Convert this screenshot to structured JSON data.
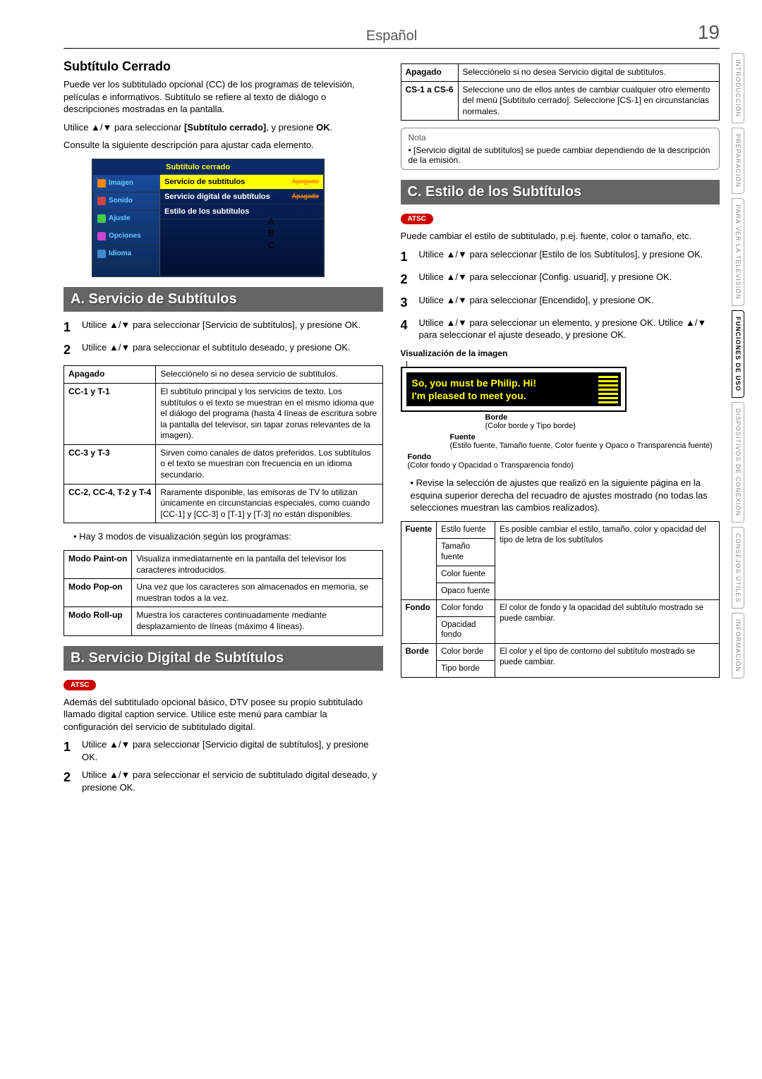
{
  "header": {
    "lang": "Español",
    "page_number": "19"
  },
  "side_tabs": [
    "INTRODUCCIÓN",
    "PREPARACIÓN",
    "PARA VER LA TELEVISIÓN",
    "FUNCIONES DE USO",
    "DISPOSITIVOS DE CONEXIÓN",
    "CONSEJOS ÚTILES",
    "INFORMACIÓN"
  ],
  "left": {
    "h2": "Subtítulo Cerrado",
    "p1": "Puede ver los subtitulado opcional (CC) de los programas de televisión, películas e informativos. Subtítulo se refiere al texto de diálogo o descripciones mostradas en la pantalla.",
    "p2a": "Utilice ▲/▼ para seleccionar ",
    "p2b": "[Subtítulo cerrado]",
    "p2c": ", y presione ",
    "p2d": "OK",
    "p2e": ".",
    "p3": "Consulte la siguiente descripción para ajustar cada elemento.",
    "tv_menu": {
      "title": "Subtítulo cerrado",
      "side": [
        "Imagen",
        "Sonido",
        "Ajuste",
        "Opciones",
        "Idioma"
      ],
      "rows": [
        {
          "label": "Servicio de subtítulos",
          "val": "Apagado"
        },
        {
          "label": "Servicio digital de subtítulos",
          "val": "Apagado"
        },
        {
          "label": "Estilo de los subtítulos",
          "val": ""
        }
      ],
      "abc": [
        "A",
        "B",
        "C"
      ]
    },
    "sectionA": "A. Servicio de Subtítulos",
    "stepsA": [
      {
        "n": "1",
        "t": "Utilice ▲/▼ para seleccionar [Servicio de subtítulos], y presione OK."
      },
      {
        "n": "2",
        "t": "Utilice ▲/▼ para seleccionar el subtítulo deseado, y presione OK."
      }
    ],
    "tableA": [
      {
        "k": "Apagado",
        "v": "Selecciónelo si no desea servicio de subtítulos."
      },
      {
        "k": "CC-1 y T-1",
        "v": "El subtítulo principal y los servicios de texto. Los subtítulos o el texto se muestran en el mismo idioma que el diálogo del programa (hasta 4 líneas de escritura sobre la pantalla del televisor, sin tapar zonas relevantes de la imagen)."
      },
      {
        "k": "CC-3 y T-3",
        "v": "Sirven como canales de datos preferidos. Los subtítulos o el texto se muestran con frecuencia en un idioma secundario."
      },
      {
        "k": "CC-2, CC-4, T-2 y T-4",
        "v": "Raramente disponible, las emisoras de TV lo utilizan únicamente en circunstancias especiales, como cuando [CC-1] y [CC-3] o [T-1] y [T-3] no están disponibles."
      }
    ],
    "bulletA": "Hay 3 modos de visualización según los programas:",
    "tableModes": [
      {
        "k": "Modo Paint-on",
        "v": "Visualiza inmediatamente en la pantalla del televisor los caracteres introducidos."
      },
      {
        "k": "Modo Pop-on",
        "v": "Una vez que los caracteres son almacenados en memoria, se muestran todos a la vez."
      },
      {
        "k": "Modo Roll-up",
        "v": "Muestra los caracteres continuadamente mediante desplazamiento de líneas (máximo 4 líneas)."
      }
    ],
    "sectionB": "B. Servicio Digital de Subtítulos",
    "atsc": "ATSC",
    "pB": "Además del subtitulado opcional básico, DTV posee su propio subtitulado llamado digital caption service. Utilice este menú para cambiar la configuración del servicio de subtitulado digital.",
    "stepsB": [
      {
        "n": "1",
        "t": "Utilice ▲/▼ para seleccionar [Servicio digital de subtítulos], y presione OK."
      },
      {
        "n": "2",
        "t": "Utilice ▲/▼ para seleccionar el servicio de subtitulado digital deseado, y presione OK."
      }
    ]
  },
  "right": {
    "tableTop": [
      {
        "k": "Apagado",
        "v": "Selecciónelo si no desea Servicio digital de subtítulos."
      },
      {
        "k": "CS-1 a CS-6",
        "v": "Seleccione uno de ellos antes de cambiar cualquier otro elemento del menú [Subtítulo cerrado]. Seleccione [CS-1] en circunstancias normales."
      }
    ],
    "note_title": "Nota",
    "note_text": "[Servicio digital de subtítulos] se puede cambiar dependiendo de la descripción de la emisión.",
    "sectionC": "C. Estilo de los Subtítulos",
    "pC": "Puede cambiar el estilo de subtitulado, p.ej. fuente, color o tamaño, etc.",
    "stepsC": [
      {
        "n": "1",
        "t": "Utilice ▲/▼ para seleccionar [Estilo de los Subtítulos], y presione OK."
      },
      {
        "n": "2",
        "t": "Utilice ▲/▼ para seleccionar [Config. usuarid], y presione OK."
      },
      {
        "n": "3",
        "t": "Utilice ▲/▼ para seleccionar [Encendido], y presione OK."
      },
      {
        "n": "4",
        "t": "Utilice ▲/▼ para seleccionar un elemento, y presione OK. Utilice ▲/▼ para seleccionar el ajuste deseado, y presione OK."
      }
    ],
    "diagram": {
      "title": "Visualización de la imagen",
      "caption1": "So, you must be Philip. Hi!",
      "caption2": "I'm pleased to meet you.",
      "borde_lbl": "Borde",
      "borde_txt": "(Color borde y Tipo borde)",
      "fuente_lbl": "Fuente",
      "fuente_txt": "(Estilo fuente, Tamaño fuente, Color fuente y Opaco o Transparencia fuente)",
      "fondo_lbl": "Fondo",
      "fondo_txt": "(Color fondo y Opacidad o Transparencia fondo)"
    },
    "bulletC": "Revise la selección de ajustes que realizó en la siguiente página en la esquina superior derecha del recuadro de ajustes mostrado (no todas las selecciones muestran las cambios realizados).",
    "settings": [
      {
        "cat": "Fuente",
        "rows": [
          "Estilo fuente",
          "Tamaño fuente",
          "Color fuente",
          "Opaco fuente"
        ],
        "desc": "Es posible cambiar el estilo, tamaño, color y opacidad del tipo de letra de los subtítulos"
      },
      {
        "cat": "Fondo",
        "rows": [
          "Color fondo",
          "Opacidad fondo"
        ],
        "desc": "El color de fondo y la opacidad del subtítulo mostrado se puede cambiar."
      },
      {
        "cat": "Borde",
        "rows": [
          "Color borde",
          "Tipo borde"
        ],
        "desc": "El color y el tipo de contorno del subtítulo mostrado se puede cambiar."
      }
    ]
  }
}
